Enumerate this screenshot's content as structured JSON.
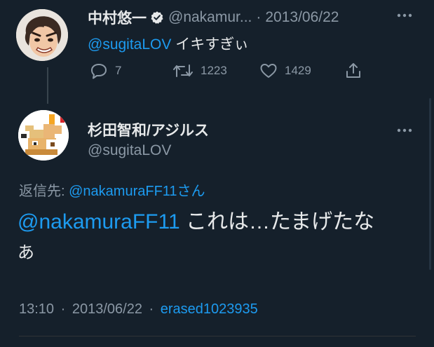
{
  "parent": {
    "name": "中村悠一",
    "handle": "@nakamur...",
    "sep": "·",
    "date": "2013/06/22",
    "mention": "@sugitaLOV",
    "text": " イキすぎぃ",
    "replies": "7",
    "retweets": "1223",
    "likes": "1429"
  },
  "main": {
    "name": "杉田智和/アジルス",
    "handle": "@sugitaLOV",
    "reply_prefix": "返信先: ",
    "reply_to": "@nakamuraFF11さん",
    "mention": "@nakamuraFF11",
    "text_line1": " これは…たまげたな",
    "text_line2": "あ",
    "time": "13:10",
    "dot1": "·",
    "date": "2013/06/22",
    "dot2": "·",
    "source": "erased1023935"
  },
  "icons": {
    "verified": "verified-badge-icon",
    "reply": "reply-icon",
    "retweet": "retweet-icon",
    "like": "heart-icon",
    "share": "share-icon",
    "more": "more-icon"
  },
  "colors": {
    "background": "#15202b",
    "accent": "#1d9bf0",
    "muted": "#8b98a5",
    "text": "#e7e9ea"
  }
}
